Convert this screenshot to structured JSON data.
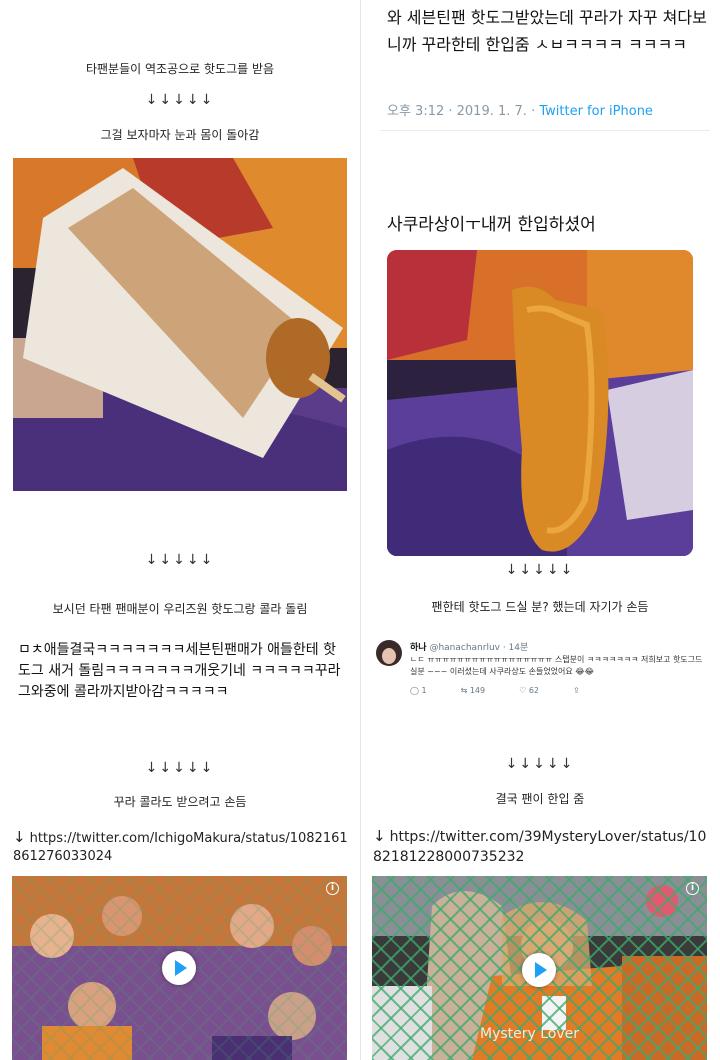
{
  "left": {
    "caption1": "타팬분들이 역조공으로 핫도그를 받음",
    "arrows1": "↓↓↓↓↓",
    "caption2": "그걸 보자마자 눈과 몸이 돌아감",
    "arrows2": "↓↓↓↓↓",
    "caption3": "보시던 타팬 팬매분이 우리즈원 핫도그랑 콜라 돌림",
    "tweet_text": "ㅁㅊ애들결국ㅋㅋㅋㅋㅋㅋㅋ세븐틴팬매가 애들한테 핫도그 새거 돌림ㅋㅋㅋㅋㅋㅋㅋ개웃기네 ㅋㅋㅋㅋㅋ꾸라그와중에 콜라까지받아감ㅋㅋㅋㅋㅋ",
    "arrows3": "↓↓↓↓↓",
    "caption4": "꾸라 콜라도 받으려고 손듬",
    "link_arrow": "↓",
    "link": "https://twitter.com/IchigoMakura/status/1082161861276033024"
  },
  "right": {
    "tweet_text": "와 세븐틴팬 핫도그받았는데 꾸라가 자꾸 쳐다보니까 꾸라한테 한입줌 ㅅㅂㅋㅋㅋㅋ ㅋㅋㅋㅋ",
    "timestamp": "오후 3:12 · 2019. 1. 7.",
    "source": "Twitter for iPhone",
    "tweet2_text": "사쿠라상이ㅜ내꺼 한입하셨어",
    "arrows1": "↓↓↓↓↓",
    "caption1": "팬한테 핫도그 드실 분? 했는데 자기가 손듬",
    "reply": {
      "name": "하나",
      "handle": "@hanachanrluv · 14분",
      "body": "ㄴㄷ ㅠㅠㅠㅠㅠㅠㅠㅠㅠㅠㅠㅠㅠㅠㅠㅠㅠ 스탭분이 ㅋㅋㅋㅋㅋㅋㅋ 저희보고 핫도그드실분 ~~~ 이러셨는데 사쿠라상도 손들었었어요 😂😂",
      "replies": "1",
      "retweets": "149",
      "likes": "62"
    },
    "arrows2": "↓↓↓↓↓",
    "caption2": "결국 팬이 한입 줌",
    "link_arrow": "↓",
    "link": "https://twitter.com/39MysteryLover/status/1082181228000735232",
    "video_watermark": "Mystery Lover"
  }
}
